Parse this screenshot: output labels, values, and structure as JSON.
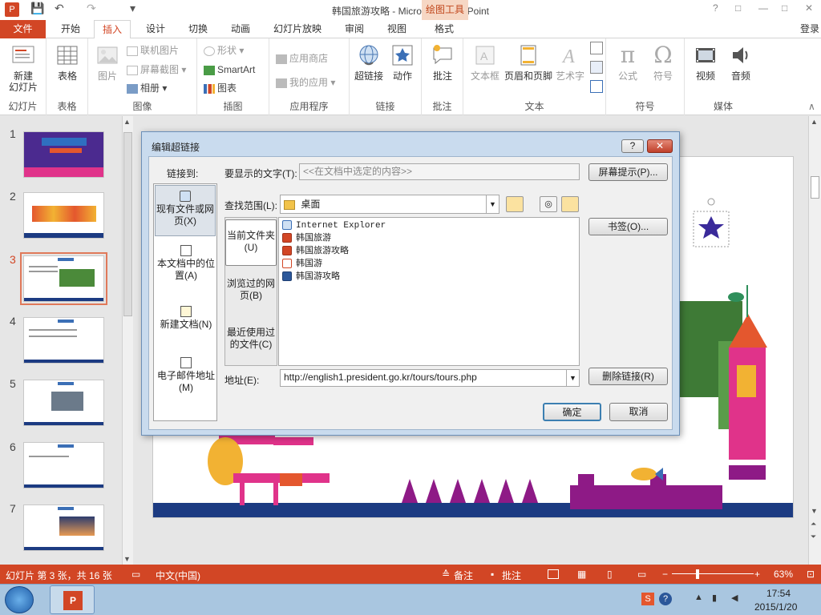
{
  "titlebar": {
    "title": "韩国旅游攻略 - Microsoft PowerPoint",
    "contextual": "绘图工具",
    "help": "?",
    "restore": "□",
    "minimize": "—",
    "maximize": "□",
    "close": "✕"
  },
  "tabs": {
    "file": "文件",
    "items": [
      "开始",
      "插入",
      "设计",
      "切换",
      "动画",
      "幻灯片放映",
      "审阅",
      "视图",
      "格式"
    ],
    "active": "插入",
    "login": "登录"
  },
  "ribbon": {
    "groups": [
      {
        "label": "幻灯片",
        "buttons": [
          "新建\n幻灯片"
        ]
      },
      {
        "label": "表格",
        "buttons": [
          "表格"
        ]
      },
      {
        "label": "图像",
        "buttons": [
          "图片"
        ],
        "small": [
          "联机图片",
          "屏幕截图",
          "相册"
        ]
      },
      {
        "label": "插图",
        "small": [
          "形状",
          "SmartArt",
          "图表"
        ]
      },
      {
        "label": "应用程序",
        "small": [
          "应用商店",
          "我的应用"
        ]
      },
      {
        "label": "链接",
        "buttons": [
          "超链接",
          "动作"
        ]
      },
      {
        "label": "批注",
        "buttons": [
          "批注"
        ]
      },
      {
        "label": "文本",
        "buttons": [
          "文本框",
          "页眉和页脚",
          "艺术字"
        ]
      },
      {
        "label": "符号",
        "buttons": [
          "公式",
          "符号"
        ]
      },
      {
        "label": "媒体",
        "buttons": [
          "视频",
          "音频"
        ]
      }
    ]
  },
  "slides": {
    "numbers": [
      "1",
      "2",
      "3",
      "4",
      "5",
      "6",
      "7"
    ],
    "selected": "3"
  },
  "dialog": {
    "title": "编辑超链接",
    "help": "?",
    "close": "✕",
    "link_to_label": "链接到:",
    "link_to": [
      "现有文件或网页(X)",
      "本文档中的位置(A)",
      "新建文档(N)",
      "电子邮件地址(M)"
    ],
    "display_text_label": "要显示的文字(T):",
    "display_text_value": "<<在文档中选定的内容>>",
    "screentip": "屏幕提示(P)...",
    "look_in_label": "查找范围(L):",
    "look_in_value": "桌面",
    "scope": [
      "当前文件夹(U)",
      "浏览过的网页(B)",
      "最近使用过的文件(C)"
    ],
    "files": [
      "Internet Explorer",
      "韩国旅游",
      "韩国旅游攻略",
      "韩国游",
      "韩国游攻略"
    ],
    "bookmark": "书签(O)...",
    "address_label": "地址(E):",
    "address_value": "http://english1.president.go.kr/tours/tours.php",
    "remove_link": "删除链接(R)",
    "ok": "确定",
    "cancel": "取消"
  },
  "status": {
    "slide_info": "幻灯片 第 3 张，共 16 张",
    "language": "中文(中国)",
    "notes": "备注",
    "comments": "批注",
    "zoom": "63%",
    "zoom_level": 0.63
  },
  "taskbar": {
    "time": "17:54",
    "date": "2015/1/20"
  },
  "colors": {
    "accent": "#d24625",
    "slide_navy": "#1c3b82",
    "slide_purple": "#8e1a86",
    "slide_pink": "#e0338a"
  }
}
